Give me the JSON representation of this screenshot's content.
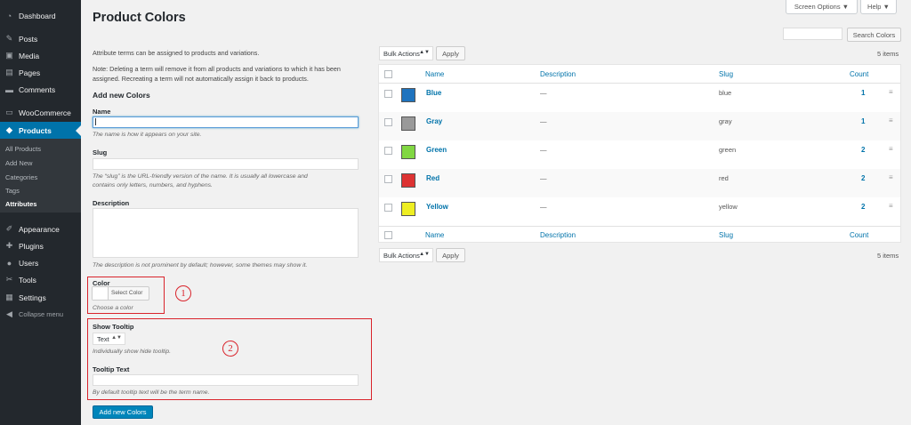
{
  "sidebar": {
    "items": [
      {
        "label": "Dashboard",
        "icon": "dashboard-icon",
        "glyph": "◔"
      },
      {
        "label": "Posts",
        "icon": "pin-icon",
        "glyph": "✎"
      },
      {
        "label": "Media",
        "icon": "media-icon",
        "glyph": "▣"
      },
      {
        "label": "Pages",
        "icon": "page-icon",
        "glyph": "▤"
      },
      {
        "label": "Comments",
        "icon": "comment-icon",
        "glyph": "▬"
      },
      {
        "label": "WooCommerce",
        "icon": "woocommerce-icon",
        "glyph": "▭"
      },
      {
        "label": "Products",
        "icon": "product-icon",
        "glyph": "◆"
      },
      {
        "label": "Appearance",
        "icon": "appearance-icon",
        "glyph": "✐"
      },
      {
        "label": "Plugins",
        "icon": "plugin-icon",
        "glyph": "✚"
      },
      {
        "label": "Users",
        "icon": "users-icon",
        "glyph": "●"
      },
      {
        "label": "Tools",
        "icon": "tools-icon",
        "glyph": "✂"
      },
      {
        "label": "Settings",
        "icon": "settings-icon",
        "glyph": "▦"
      },
      {
        "label": "Collapse menu",
        "icon": "collapse-icon",
        "glyph": "◀"
      }
    ],
    "submenu": [
      "All Products",
      "Add New",
      "Categories",
      "Tags",
      "Attributes"
    ]
  },
  "header": {
    "title": "Product Colors",
    "screen_options": "Screen Options ▼",
    "help": "Help ▼",
    "search_button": "Search Colors"
  },
  "form": {
    "intro": "Attribute terms can be assigned to products and variations.",
    "note_line1": "Note: Deleting a term will remove it from all products and variations to which it has been",
    "note_line2": "assigned. Recreating a term will not automatically assign it back to products.",
    "heading": "Add new Colors",
    "name_label": "Name",
    "name_desc": "The name is how it appears on your site.",
    "slug_label": "Slug",
    "slug_desc1": "The “slug” is the URL-friendly version of the name. It is usually all lowercase and",
    "slug_desc2": "contains only letters, numbers, and hyphens.",
    "description_label": "Description",
    "description_desc": "The description is not prominent by default; however, some themes may show it.",
    "color_label": "Color",
    "select_color": "Select Color",
    "choose_color": "Choose a color",
    "show_tooltip_label": "Show Tooltip",
    "tooltip_value": "Text",
    "tooltip_desc": "Individually show hide tooltip.",
    "tooltip_text_label": "Tooltip Text",
    "tooltip_text_desc": "By default tooltip text will be the term name.",
    "submit": "Add new Colors",
    "annotation_1": "1",
    "annotation_2": "2"
  },
  "table": {
    "bulk_actions": "Bulk Actions",
    "apply": "Apply",
    "items_count": "5 items",
    "columns": {
      "name": "Name",
      "description": "Description",
      "slug": "Slug",
      "count": "Count"
    },
    "rows": [
      {
        "name": "Blue",
        "description": "—",
        "slug": "blue",
        "count": "1",
        "color": "#1e73be"
      },
      {
        "name": "Gray",
        "description": "—",
        "slug": "gray",
        "count": "1",
        "color": "#999999"
      },
      {
        "name": "Green",
        "description": "—",
        "slug": "green",
        "count": "2",
        "color": "#81d742"
      },
      {
        "name": "Red",
        "description": "—",
        "slug": "red",
        "count": "2",
        "color": "#dd3333"
      },
      {
        "name": "Yellow",
        "description": "—",
        "slug": "yellow",
        "count": "2",
        "color": "#eeee22"
      }
    ]
  },
  "colors": {
    "accent": "#0073aa",
    "annotation": "#d9232b",
    "sidebar": "#23282d"
  }
}
